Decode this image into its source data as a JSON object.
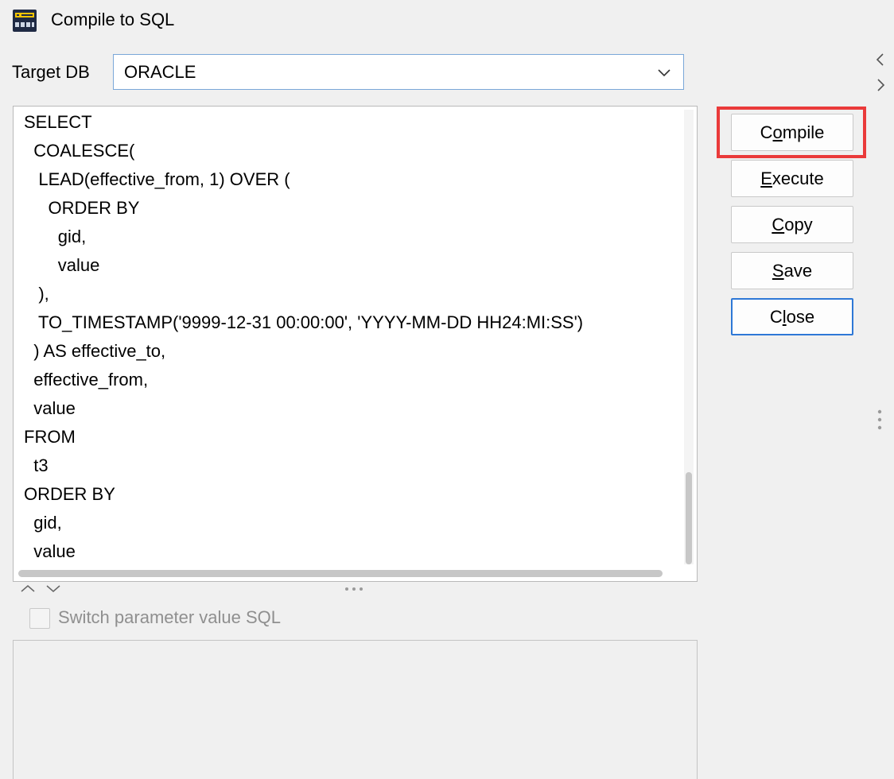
{
  "window": {
    "title": "Compile to SQL"
  },
  "target_db": {
    "label": "Target DB",
    "value": "ORACLE"
  },
  "sql": {
    "lines": [
      "SELECT",
      "  COALESCE(",
      "   LEAD(effective_from, 1) OVER (",
      "     ORDER BY",
      "       gid,",
      "       value",
      "   ),",
      "   TO_TIMESTAMP('9999-12-31 00:00:00', 'YYYY-MM-DD HH24:MI:SS')",
      "  ) AS effective_to,",
      "  effective_from,",
      "  value",
      "FROM",
      "  t3",
      "ORDER BY",
      "  gid,",
      "  value"
    ]
  },
  "buttons": {
    "compile": {
      "pre": "C",
      "mnemonic": "o",
      "post": "mpile"
    },
    "execute": {
      "pre": "",
      "mnemonic": "E",
      "post": "xecute"
    },
    "copy": {
      "pre": "",
      "mnemonic": "C",
      "post": "opy"
    },
    "save": {
      "pre": "",
      "mnemonic": "S",
      "post": "ave"
    },
    "close": {
      "pre": "C",
      "mnemonic": "l",
      "post": "ose"
    }
  },
  "switch_param": {
    "label": "Switch parameter value SQL",
    "checked": false
  },
  "colors": {
    "highlight": "#ea3a3a",
    "focus": "#2e78d6"
  },
  "icons": [
    "app-icon",
    "chevron-down-icon",
    "chevron-left-icon",
    "chevron-right-icon",
    "chevron-up-icon",
    "more-vertical-icon",
    "more-horizontal-icon"
  ]
}
